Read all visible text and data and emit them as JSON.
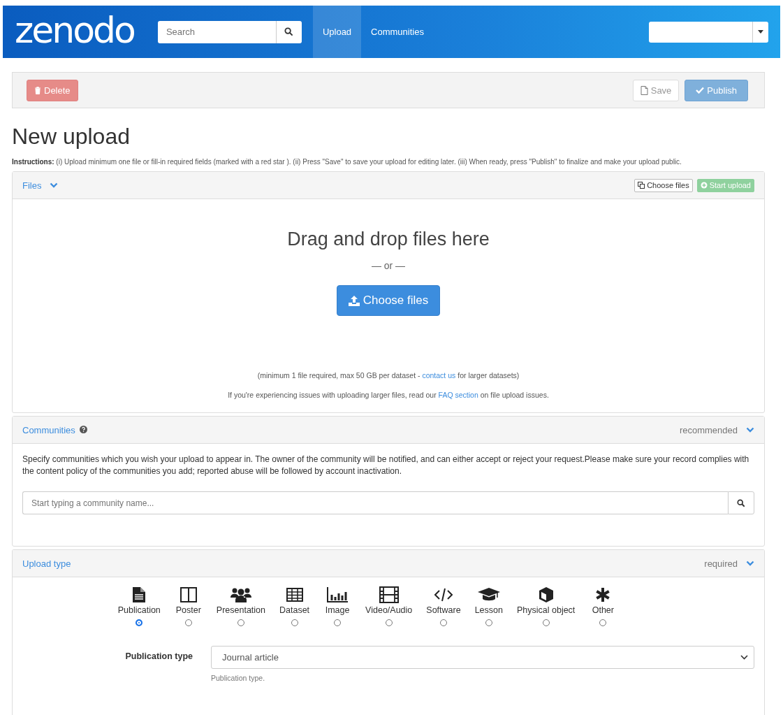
{
  "header": {
    "logo": "zenodo",
    "search": {
      "placeholder": "Search"
    },
    "nav": [
      {
        "label": "Upload",
        "selected": true
      },
      {
        "label": "Communities",
        "selected": false
      }
    ]
  },
  "toolbar": {
    "delete": "Delete",
    "save": "Save",
    "publish": "Publish"
  },
  "title": "New upload",
  "instructions": "**Instructions:** (i) Upload minimum one file or fill-in required fields (marked with a red star ). (ii) Press \"Save\" to save your upload for editing later. (iii) When ready, press \"Publish\" to finalize and make your upload public.",
  "files": {
    "title": "Files",
    "choose": "Choose files",
    "start": "Start upload",
    "drop": "Drag and drop files here",
    "or": "— or —",
    "choose_big": "Choose files",
    "note1": {
      "before": "(minimum 1 file required, max 50 GB per dataset - ",
      "link": "contact us",
      "after": " for larger datasets)"
    },
    "note2": {
      "before": "If you're experiencing issues with uploading larger files, read our ",
      "link": "FAQ section",
      "after": " on file upload issues."
    }
  },
  "communities": {
    "title": "Communities",
    "badge": "recommended",
    "text": "Specify communities which you wish your upload to appear in. The owner of the community will be notified, and can either accept or reject your request.Please make sure your record complies with the content policy of the communities you add; reported abuse will be followed by account inactivation.",
    "placeholder": "Start typing a community name..."
  },
  "upload_type": {
    "title": "Upload type",
    "badge": "required",
    "types": [
      {
        "kind": "publication",
        "label": "Publication",
        "selected": true
      },
      {
        "kind": "poster",
        "label": "Poster",
        "selected": false
      },
      {
        "kind": "presentation",
        "label": "Presentation",
        "selected": false
      },
      {
        "kind": "dataset",
        "label": "Dataset",
        "selected": false
      },
      {
        "kind": "image",
        "label": "Image",
        "selected": false
      },
      {
        "kind": "video",
        "label": "Video/Audio",
        "selected": false
      },
      {
        "kind": "software",
        "label": "Software",
        "selected": false
      },
      {
        "kind": "lesson",
        "label": "Lesson",
        "selected": false
      },
      {
        "kind": "physical",
        "label": "Physical object",
        "selected": false
      },
      {
        "kind": "other",
        "label": "Other",
        "selected": false
      }
    ],
    "publication_type": {
      "label": "Publication type",
      "value": "Journal article",
      "help": "Publication type."
    }
  }
}
